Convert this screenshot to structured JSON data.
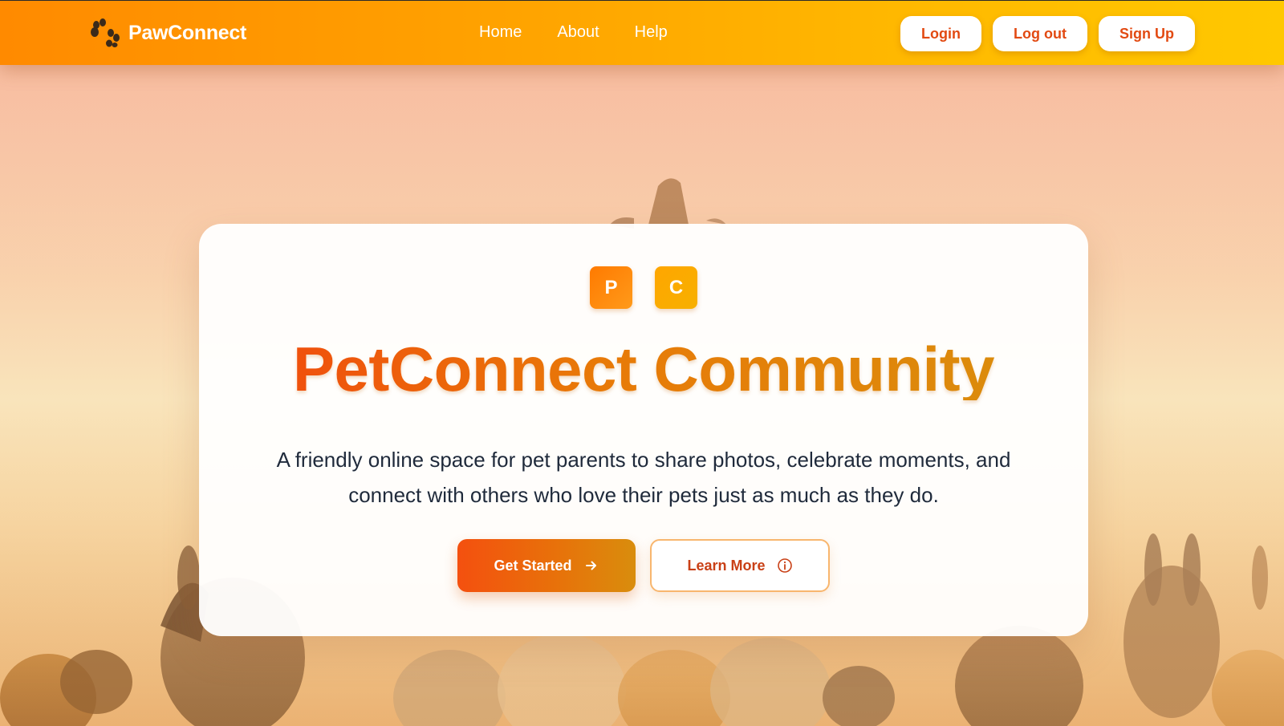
{
  "brand": {
    "name": "PawConnect",
    "icon": "paw-icon"
  },
  "nav": {
    "links": [
      "Home",
      "About",
      "Help"
    ],
    "actions": {
      "login": "Login",
      "logout": "Log out",
      "signup": "Sign Up"
    }
  },
  "hero": {
    "badges": [
      "P",
      "C"
    ],
    "title": "PetConnect Community",
    "subtitle": "A friendly online space for pet parents to share photos, celebrate moments, and connect with others who love their pets just as much as they do.",
    "primary_cta": {
      "label": "Get Started",
      "icon": "arrow-right-icon"
    },
    "secondary_cta": {
      "label": "Learn More",
      "icon": "info-circle-icon"
    }
  },
  "colors": {
    "nav_gradient_start": "#ff8a00",
    "nav_gradient_end": "#ffc800",
    "accent": "#e24a12",
    "title_gradient_start": "#f2440e",
    "title_gradient_end": "#d98f0c",
    "text_dark": "#1f2a3b"
  }
}
